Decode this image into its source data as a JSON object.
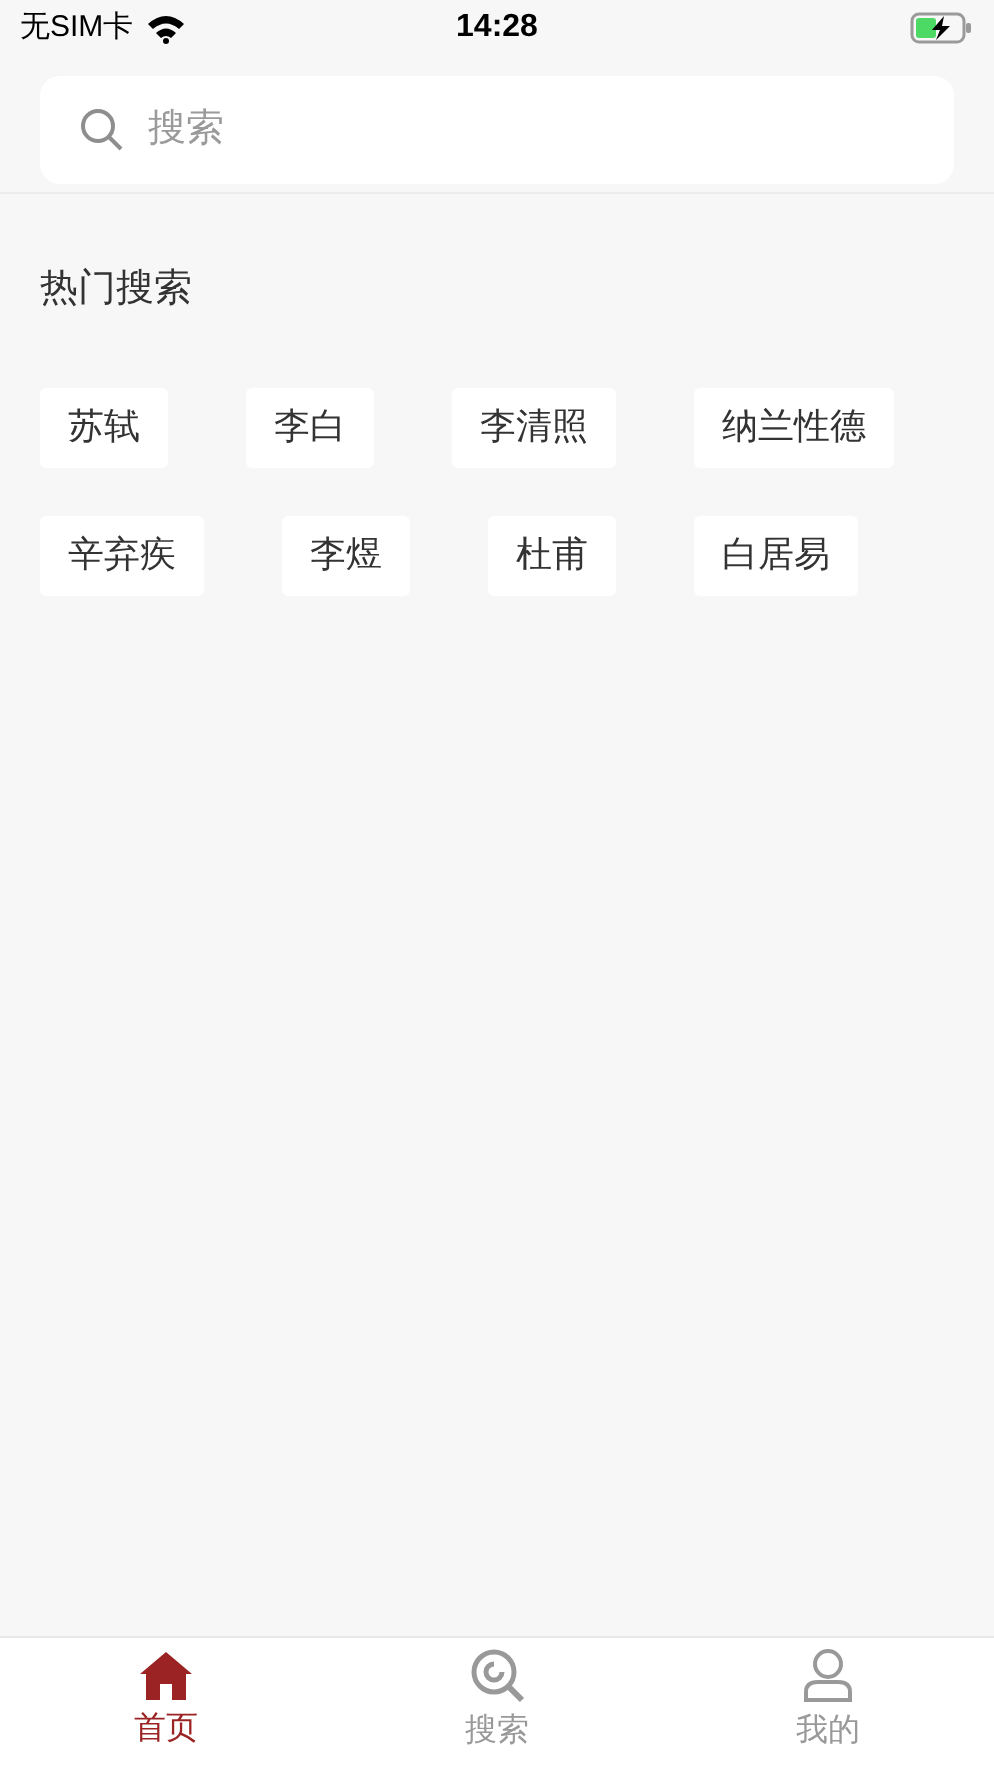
{
  "status_bar": {
    "carrier": "无SIM卡",
    "time": "14:28"
  },
  "search": {
    "placeholder": "搜索"
  },
  "hot_search": {
    "title": "热门搜索",
    "tags": [
      "苏轼",
      "李白",
      "李清照",
      "纳兰性德",
      "辛弃疾",
      "李煜",
      "杜甫",
      "白居易"
    ]
  },
  "tab_bar": [
    {
      "label": "首页",
      "selected": true,
      "kind": "home"
    },
    {
      "label": "搜索",
      "selected": false,
      "kind": "search"
    },
    {
      "label": "我的",
      "selected": false,
      "kind": "profile"
    }
  ]
}
